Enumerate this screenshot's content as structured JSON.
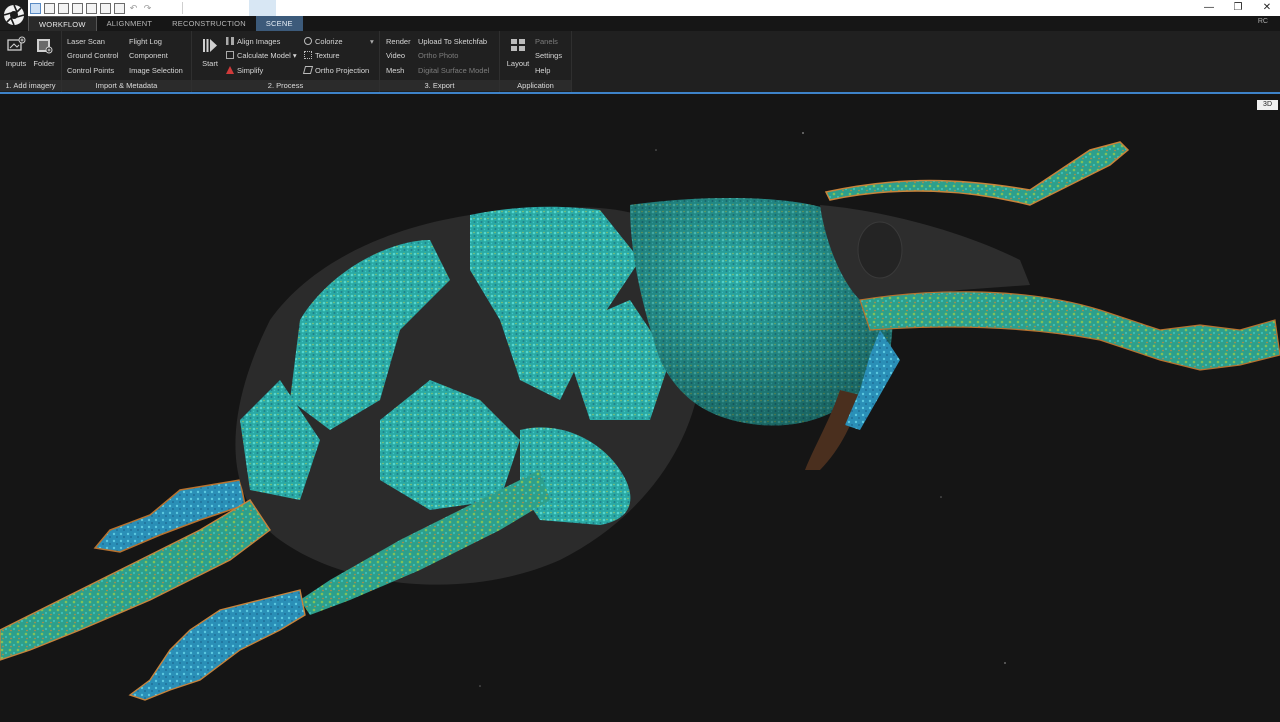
{
  "titlebar": {
    "title_value": "",
    "minimize_symbol": "—",
    "restore_symbol": "❐",
    "close_symbol": "✕"
  },
  "tabs": [
    {
      "label": "WORKFLOW",
      "state": "active"
    },
    {
      "label": "ALIGNMENT",
      "state": "normal"
    },
    {
      "label": "RECONSTRUCTION",
      "state": "normal"
    },
    {
      "label": "SCENE",
      "state": "highlight"
    }
  ],
  "user_badge": "RC",
  "ribbon": {
    "add_imagery": {
      "label": "1. Add imagery",
      "inputs": "Inputs",
      "folder": "Folder"
    },
    "import_metadata": {
      "label": "Import & Metadata",
      "col1": [
        "Laser Scan",
        "Ground Control",
        "Control Points"
      ],
      "col2": [
        "Flight Log",
        "Component",
        "Image Selection"
      ]
    },
    "process": {
      "label": "2. Process",
      "start": "Start",
      "col1": [
        "Align Images",
        "Calculate Model",
        "Simplify"
      ],
      "col2": [
        "Colorize",
        "Texture",
        "Ortho Projection"
      ]
    },
    "export": {
      "label": "3. Export",
      "col1": [
        "Render",
        "Video",
        "Mesh"
      ],
      "col2": [
        "Upload To Sketchfab",
        "Ortho Photo",
        "Digital Surface Model"
      ]
    },
    "application": {
      "label": "Application",
      "layout": "Layout",
      "col": [
        "Panels",
        "Settings",
        "Help"
      ]
    }
  },
  "viewport": {
    "mode_badge": "3D"
  },
  "colors": {
    "accent_blue": "#3e83c9",
    "ribbon_bg": "#202020",
    "viewport_bg": "#151515",
    "weevil_teal": "#2fb8b0",
    "weevil_dark": "#2a2a2a"
  }
}
